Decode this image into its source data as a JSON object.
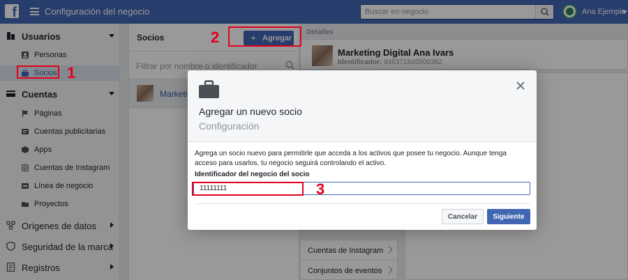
{
  "header": {
    "app_title": "Configuración del negocio",
    "search_placeholder": "Buscar en negocio",
    "user_name": "Ana Ejemplo",
    "brand_color": "#4267b2",
    "logo_icon": "facebook-logo"
  },
  "sidebar": {
    "sections": [
      {
        "label": "Usuarios",
        "icon": "users-icon",
        "expanded": true,
        "items": [
          {
            "label": "Personas",
            "icon": "person-card-icon"
          },
          {
            "label": "Socios",
            "icon": "briefcase-icon",
            "active": true
          }
        ]
      },
      {
        "label": "Cuentas",
        "icon": "accounts-icon",
        "expanded": true,
        "items": [
          {
            "label": "Páginas",
            "icon": "flag-icon"
          },
          {
            "label": "Cuentas publicitarias",
            "icon": "ad-account-icon"
          },
          {
            "label": "Apps",
            "icon": "cube-icon"
          },
          {
            "label": "Cuentas de Instagram",
            "icon": "instagram-icon"
          },
          {
            "label": "Línea de negocio",
            "icon": "line-icon"
          },
          {
            "label": "Proyectos",
            "icon": "folder-icon"
          }
        ]
      },
      {
        "label": "Orígenes de datos",
        "icon": "data-sources-icon",
        "expanded": false
      },
      {
        "label": "Seguridad de la marca",
        "icon": "shield-icon",
        "expanded": false
      },
      {
        "label": "Registros",
        "icon": "log-icon",
        "expanded": false
      }
    ]
  },
  "partners": {
    "title": "Socios",
    "add_label": "Agregar",
    "filter_placeholder": "Filtrar por nombre o identificador",
    "list": [
      {
        "name": "Marketing"
      }
    ]
  },
  "details": {
    "label": "Detalles",
    "name": "Marketing Digital Ana Ivars",
    "id_label": "Identificador:",
    "id_value": "946371845500382",
    "assets": [
      "Cuentas de Instagram",
      "Conjuntos de eventos"
    ]
  },
  "modal": {
    "title": "Agregar un nuevo socio",
    "subtitle": "Configuración",
    "description": "Agrega un socio nuevo para permitirle que acceda a los activos que posee tu negocio. Aunque tenga acceso para usarlos, tu negocio seguirá controlando el activo.",
    "field_label": "Identificador del negocio del socio",
    "field_value": "11111111",
    "cancel_label": "Cancelar",
    "next_label": "Siguiente"
  },
  "annotations": {
    "color": "#e3001b",
    "labels": [
      "1",
      "2",
      "3"
    ]
  }
}
